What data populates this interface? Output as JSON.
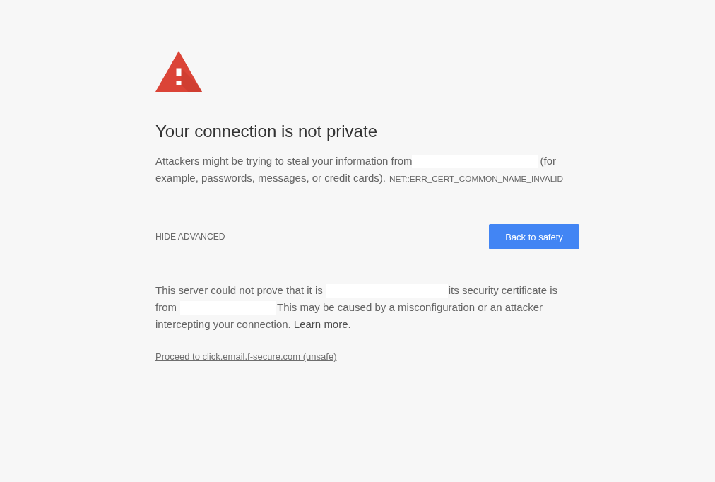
{
  "heading": "Your connection is not private",
  "summary": {
    "parts": [
      {
        "kind": "text",
        "text": "Attackers might be trying to steal your information from"
      },
      {
        "kind": "redacted"
      },
      {
        "kind": "text",
        "text": "(for example, passwords, messages, or credit cards)."
      }
    ],
    "error_code": "NET::ERR_CERT_COMMON_NAME_INVALID"
  },
  "actions": {
    "advanced_toggle": "HIDE ADVANCED",
    "back_button": "Back to safety"
  },
  "details": {
    "parts": [
      {
        "kind": "text",
        "text": "This server could not prove that it is"
      },
      {
        "kind": "redacted"
      },
      {
        "kind": "text",
        "text": "its security certificate is from"
      },
      {
        "kind": "redacted"
      },
      {
        "kind": "text",
        "text": "This may be caused by a misconfiguration or an attacker intercepting your connection."
      },
      {
        "kind": "link",
        "text": "Learn more"
      },
      {
        "kind": "text",
        "text": "."
      }
    ]
  },
  "proceed_link": "Proceed to click.email.f-secure.com (unsafe)"
}
